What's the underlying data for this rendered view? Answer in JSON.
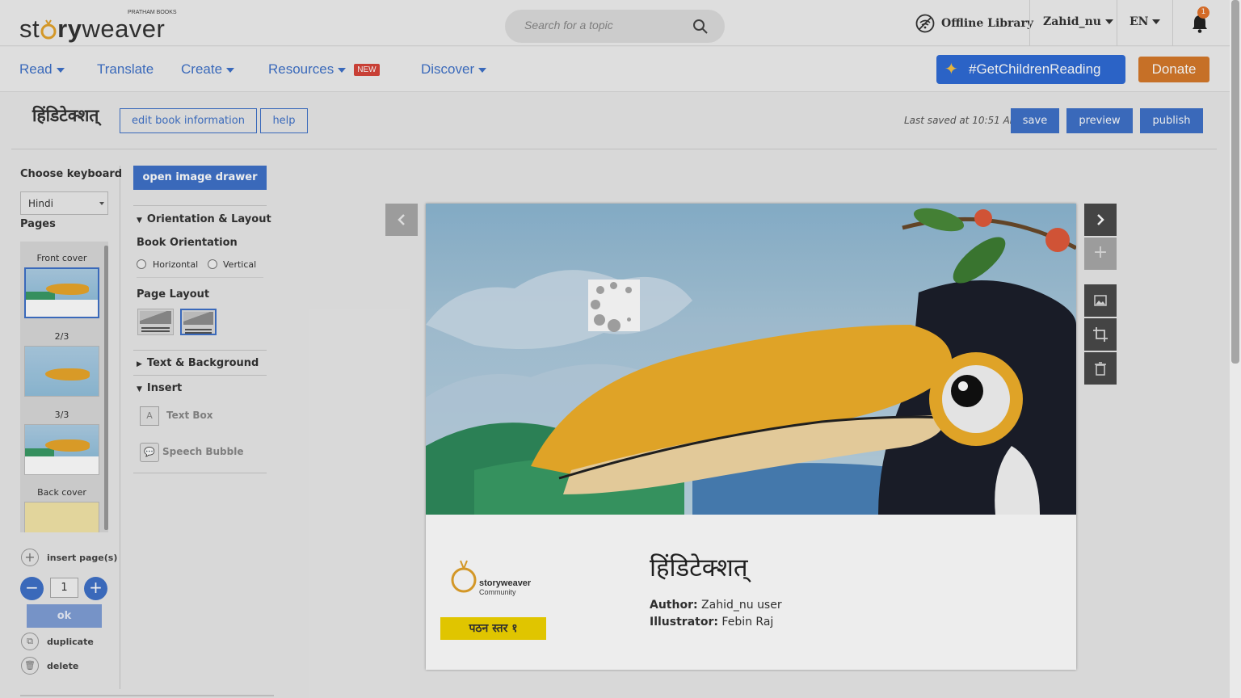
{
  "header": {
    "logo_text_a": "st",
    "logo_text_b": "ry",
    "logo_text_c": "weaver",
    "logo_publisher": "PRATHAM BOOKS",
    "search_placeholder": "Search for a topic",
    "offline_library": "Offline Library",
    "user_name": "Zahid_nu",
    "language": "EN",
    "notification_count": "1"
  },
  "nav": {
    "read": "Read",
    "translate": "Translate",
    "create": "Create",
    "resources": "Resources",
    "resources_badge": "NEW",
    "discover": "Discover",
    "campaign": "#GetChildrenReading",
    "donate": "Donate"
  },
  "editor": {
    "book_title": "हिंडिटेक्शत्",
    "edit_info": "edit book information",
    "help": "help",
    "last_saved": "Last saved at 10:51 AM",
    "save": "save",
    "preview": "preview",
    "publish": "publish"
  },
  "sidebar": {
    "choose_keyboard": "Choose keyboard",
    "keyboard_value": "Hindi",
    "pages_label": "Pages",
    "pages": [
      {
        "label": "Front cover"
      },
      {
        "label": "2/3"
      },
      {
        "label": "3/3"
      },
      {
        "label": "Back cover"
      }
    ],
    "insert_pages": "insert page(s)",
    "quantity": "1",
    "ok": "ok",
    "duplicate": "duplicate",
    "delete": "delete"
  },
  "tools": {
    "open_image_drawer": "open image drawer",
    "orientation_layout": "Orientation & Layout",
    "book_orientation": "Book Orientation",
    "horizontal": "Horizontal",
    "vertical": "Vertical",
    "page_layout": "Page Layout",
    "text_background": "Text & Background",
    "insert": "Insert",
    "text_box": "Text Box",
    "speech_bubble": "Speech Bubble"
  },
  "cover": {
    "title": "हिंडिटेक्शत्",
    "author_label": "Author:",
    "author": "Zahid_nu user",
    "illustrator_label": "Illustrator:",
    "illustrator": "Febin Raj",
    "community_logo_a": "storyweaver",
    "community_logo_b": "Community",
    "level_badge": "पठन स्तर १"
  },
  "colors": {
    "accent": "#3f72c9",
    "donate": "#d6792a",
    "level_badge": "#f2d400",
    "notification": "#e3732b"
  }
}
